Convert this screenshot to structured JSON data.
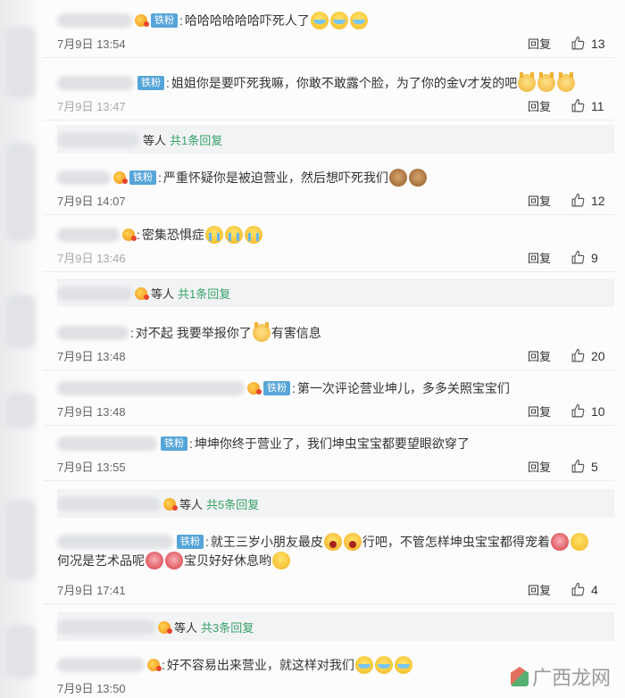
{
  "labels": {
    "fan_badge": "铁粉",
    "reply": "回复",
    "others": "等人"
  },
  "comments": [
    {
      "text": "哈哈哈哈哈哈吓死人了",
      "time": "7月9日 13:54",
      "likes": "13"
    },
    {
      "text": "姐姐你是要吓死我嘛，你敢不敢露个脸，为了你的金V才发的吧",
      "time": "7月9日 13:47",
      "likes": "11"
    },
    {
      "text": "严重怀疑你是被迫营业，然后想吓死我们",
      "time": "7月9日 14:07",
      "likes": "12"
    },
    {
      "text": "密集恐惧症",
      "time": "7月9日 13:46",
      "likes": "9"
    },
    {
      "text": "对不起 我要举报你了",
      "text2": "有害信息",
      "time": "7月9日 13:48",
      "likes": "20"
    },
    {
      "text": "第一次评论营业坤儿，多多关照宝宝们",
      "time": "7月9日 13:48",
      "likes": "10"
    },
    {
      "text": "坤坤你终于营业了，我们坤虫宝宝都要望眼欲穿了",
      "time": "7月9日 13:55",
      "likes": "5"
    },
    {
      "text": "就王三岁小朋友最皮",
      "text2": "行吧，不管怎样坤虫宝宝都得宠着",
      "line2a": "何况是艺术品呢",
      "line2b": "宝贝好好休息哟",
      "time": "7月9日 17:41",
      "likes": "4"
    },
    {
      "text": "好不容易出来营业，就这样对我们",
      "time": "7月9日 13:50"
    }
  ],
  "reply_summaries": [
    {
      "total": "共1条回复"
    },
    {
      "total": "共1条回复"
    },
    {
      "total": "共5条回复"
    },
    {
      "total": "共3条回复"
    }
  ],
  "watermark": {
    "text": "广西龙网"
  },
  "colors": {
    "fan_badge": "#56a5d8",
    "reply_total": "#38a169",
    "summary_bg": "#f2f3f5"
  }
}
